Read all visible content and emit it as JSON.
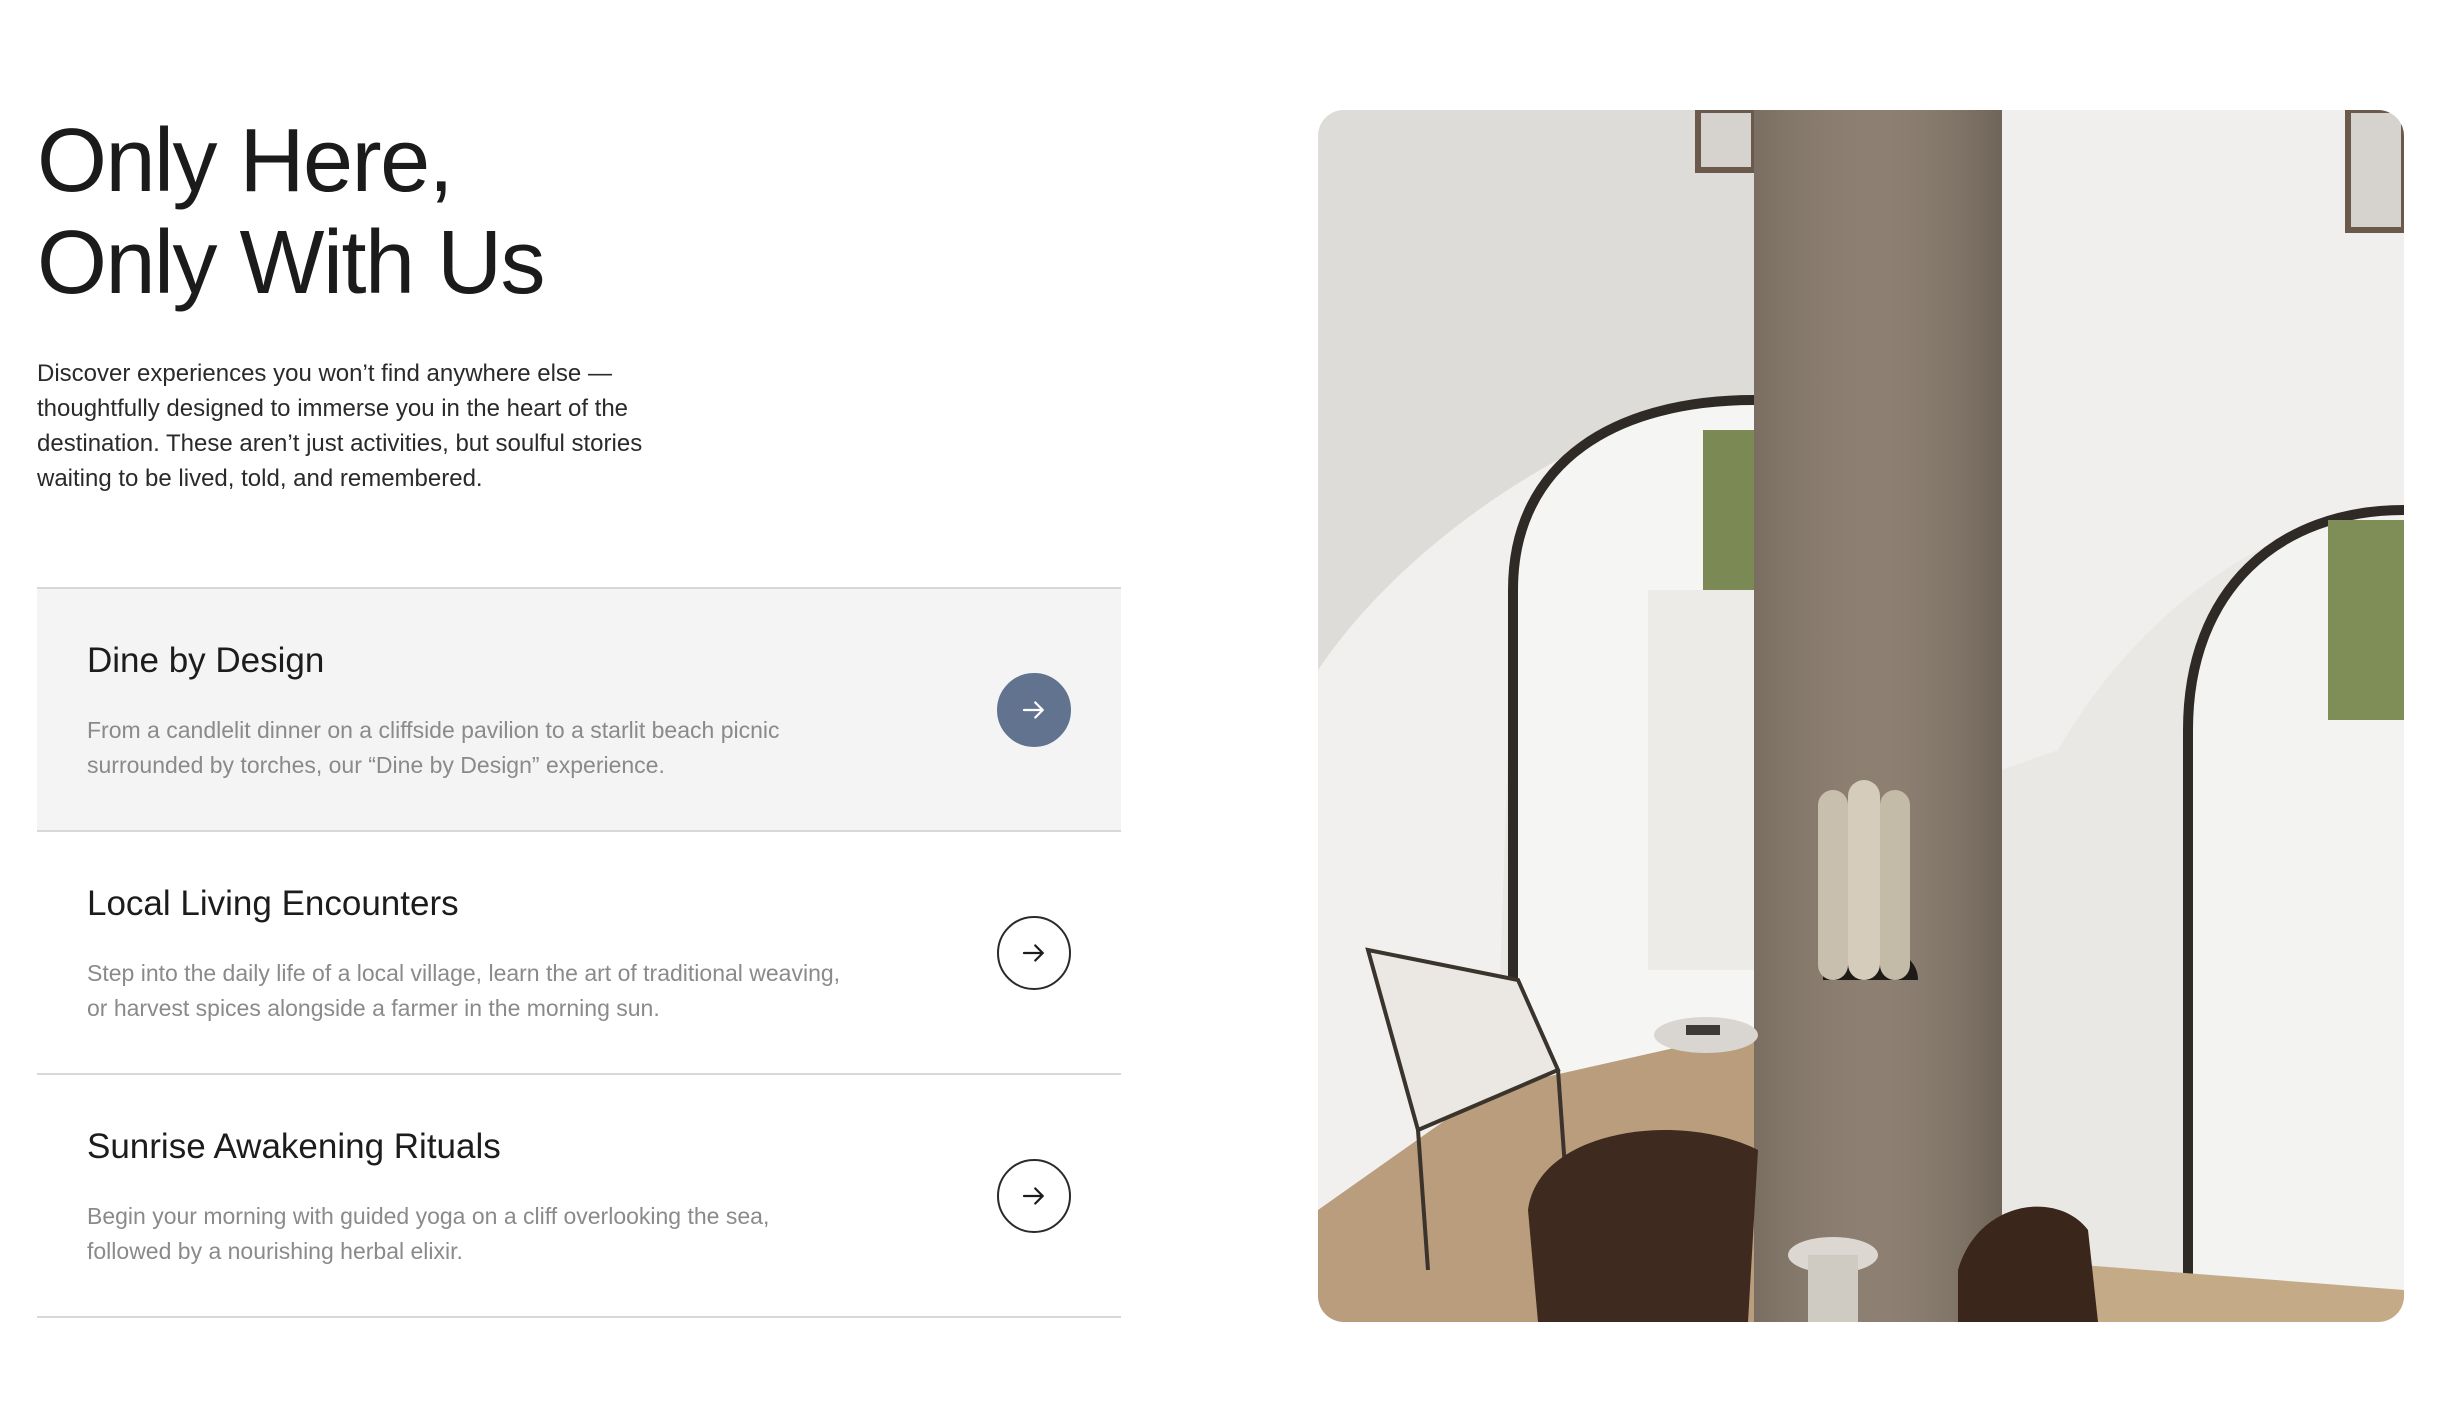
{
  "section": {
    "title_line1": "Only Here,",
    "title_line2": "Only With Us",
    "intro": "Discover experiences you won’t find anywhere else — thoughtfully designed to immerse you in the heart of the destination. These aren’t just activities, but soulful stories waiting to be lived, told, and remembered."
  },
  "experiences": [
    {
      "title": "Dine by Design",
      "description": "From a candlelit dinner on a cliffside pavilion to a starlit beach picnic surrounded by torches, our “Dine by Design” experience.",
      "active": true,
      "icon": "arrow-right-icon"
    },
    {
      "title": "Local Living Encounters",
      "description": "Step into the daily life of a local village, learn the art of traditional weaving, or harvest spices alongside a farmer in the morning sun.",
      "active": false,
      "icon": "arrow-right-icon"
    },
    {
      "title": "Sunrise Awakening Rituals",
      "description": "Begin your morning with guided yoga on a cliff overlooking the sea, followed by a nourishing herbal elixir.",
      "active": false,
      "icon": "arrow-right-icon"
    }
  ],
  "colors": {
    "accent": "#62738f",
    "active_row_bg": "#f4f4f4",
    "divider": "#d8d8d8",
    "muted_text": "#8a8a8a"
  }
}
